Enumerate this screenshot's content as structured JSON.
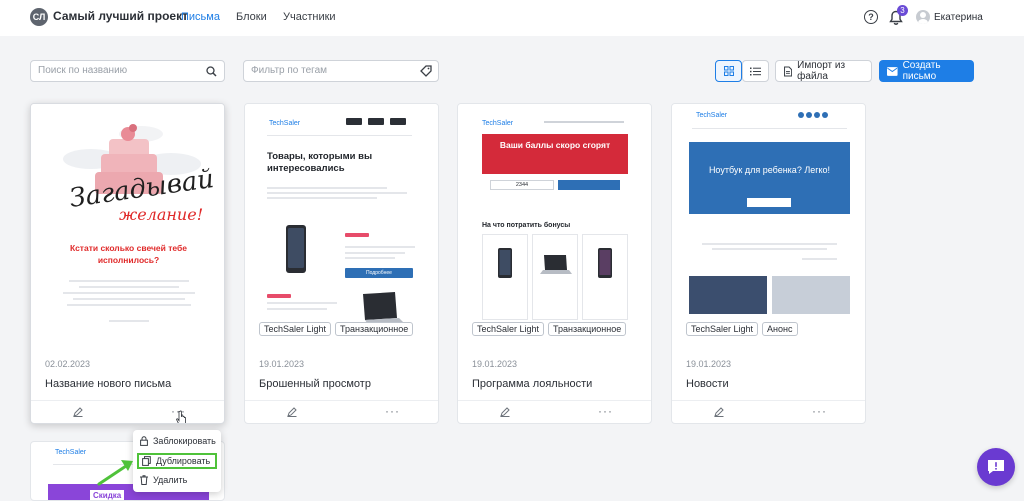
{
  "app": {
    "logo_text": "СЛ",
    "project_name": "Самый лучший проект"
  },
  "nav": [
    {
      "label": "Письма",
      "active": true
    },
    {
      "label": "Блоки",
      "active": false
    },
    {
      "label": "Участники",
      "active": false
    }
  ],
  "header": {
    "help_label": "?",
    "notifications_count": "3",
    "user_name": "Екатерина"
  },
  "toolbar": {
    "search_placeholder": "Поиск по названию",
    "filter_placeholder": "Фильтр по тегам",
    "import_label": "Импорт из файла",
    "create_label": "Создать письмо"
  },
  "cards": [
    {
      "date": "02.02.2023",
      "title": "Название нового письма",
      "tags": [],
      "preview": {
        "script_top": "Загадывай",
        "script_bottom": "желание!",
        "headline": "Кстати сколько свечей тебе исполнилось?"
      }
    },
    {
      "date": "19.01.2023",
      "title": "Брошенный просмотр",
      "tags": [
        "TechSaler Light",
        "Транзакционное"
      ],
      "preview": {
        "brand": "TechSaler",
        "headline": "Товары, которыми вы интересовались",
        "button": "Подробнее"
      }
    },
    {
      "date": "19.01.2023",
      "title": "Программа лояльности",
      "tags": [
        "TechSaler Light",
        "Транзакционное"
      ],
      "preview": {
        "brand": "TechSaler",
        "banner": "Ваши баллы скоро сгорят",
        "points": "2344",
        "section": "На что потратить бонусы"
      }
    },
    {
      "date": "19.01.2023",
      "title": "Новости",
      "tags": [
        "TechSaler Light",
        "Анонс"
      ],
      "preview": {
        "brand": "TechSaler",
        "hero": "Ноутбук для ребенка? Легко!"
      }
    }
  ],
  "partial_card": {
    "brand": "TechSaler",
    "sale": "Скидка"
  },
  "context_menu": [
    {
      "label": "Заблокировать",
      "icon": "lock-icon"
    },
    {
      "label": "Дублировать",
      "icon": "copy-icon",
      "highlighted": true
    },
    {
      "label": "Удалить",
      "icon": "trash-icon"
    }
  ],
  "colors": {
    "accent": "#1e7ee6",
    "badge": "#6a4bd6",
    "highlight": "#4fc23a",
    "fab": "#6a3ad1"
  }
}
